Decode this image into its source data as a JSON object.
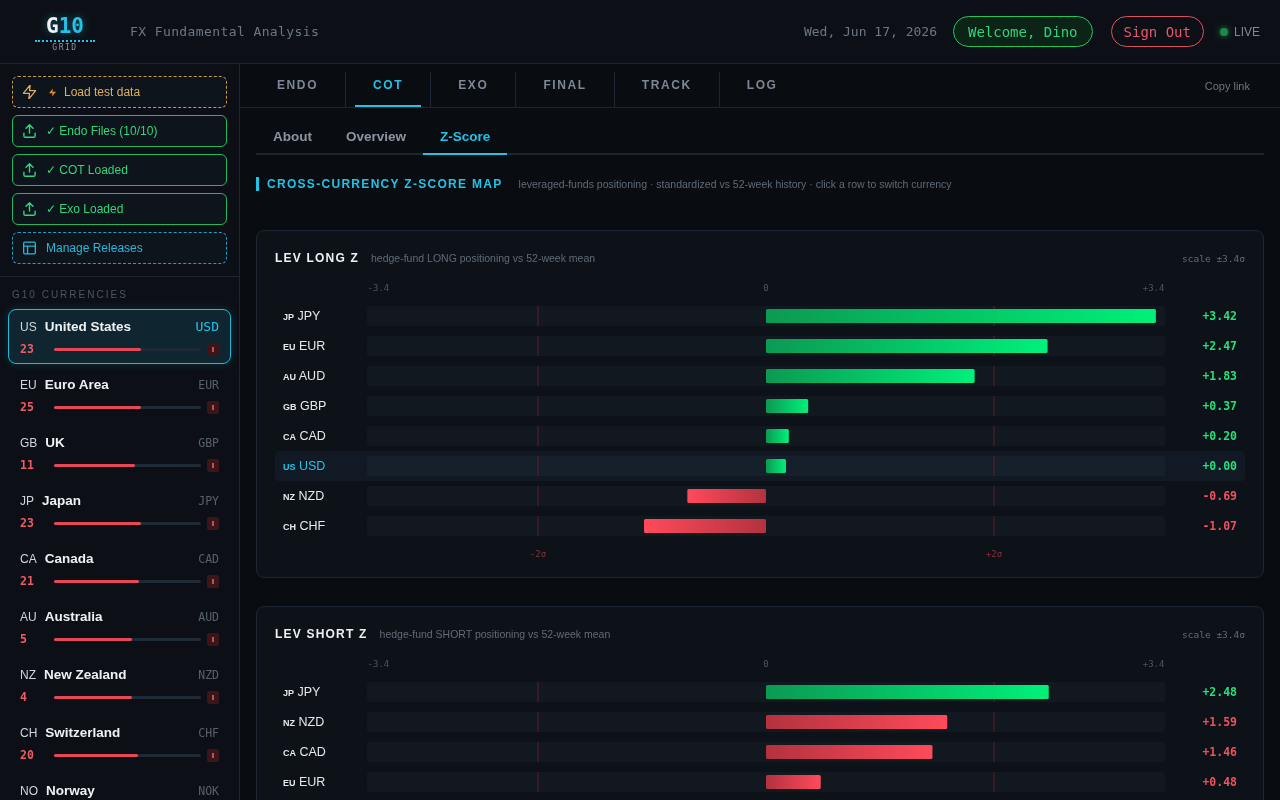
{
  "header": {
    "logo": {
      "mark": "G",
      "accent": "10",
      "caption": "GRID"
    },
    "subtitle": "FX Fundamental Analysis",
    "date": "Wed, Jun 17, 2026",
    "welcome": "Welcome, Dino",
    "sign_out": "Sign Out",
    "status": {
      "label": "LIVE",
      "on": true
    }
  },
  "sidebar": {
    "actions": [
      {
        "kind": "demo",
        "label": "Load test data"
      },
      {
        "kind": "upload",
        "label": "✓ Endo Files (10/10)"
      },
      {
        "kind": "upload",
        "label": "✓ COT Loaded"
      },
      {
        "kind": "upload",
        "label": "✓ Exo Loaded"
      },
      {
        "kind": "releases",
        "label": "Manage Releases"
      }
    ],
    "currencies_title": "G10 CURRENCIES",
    "currencies": [
      {
        "country": "US",
        "name": "United States",
        "code": "USD",
        "score": "23",
        "level": 0.59,
        "selected": true
      },
      {
        "country": "EU",
        "name": "Euro Area",
        "code": "EUR",
        "score": "25",
        "level": 0.59,
        "selected": false
      },
      {
        "country": "GB",
        "name": "UK",
        "code": "GBP",
        "score": "11",
        "level": 0.55,
        "selected": false
      },
      {
        "country": "JP",
        "name": "Japan",
        "code": "JPY",
        "score": "23",
        "level": 0.59,
        "selected": false
      },
      {
        "country": "CA",
        "name": "Canada",
        "code": "CAD",
        "score": "21",
        "level": 0.58,
        "selected": false
      },
      {
        "country": "AU",
        "name": "Australia",
        "code": "AUD",
        "score": "5",
        "level": 0.53,
        "selected": false
      },
      {
        "country": "NZ",
        "name": "New Zealand",
        "code": "NZD",
        "score": "4",
        "level": 0.53,
        "selected": false
      },
      {
        "country": "CH",
        "name": "Switzerland",
        "code": "CHF",
        "score": "20",
        "level": 0.57,
        "selected": false
      },
      {
        "country": "NO",
        "name": "Norway",
        "code": "NOK",
        "selected": false
      }
    ]
  },
  "tabs": [
    {
      "label": "ENDO",
      "selected": false
    },
    {
      "label": "COT",
      "selected": true
    },
    {
      "label": "EXO",
      "selected": false
    },
    {
      "label": "FINAL",
      "selected": false
    },
    {
      "label": "TRACK",
      "selected": false
    },
    {
      "label": "LOG",
      "selected": false
    }
  ],
  "copy_link": "Copy link",
  "subtabs": [
    {
      "label": "About",
      "selected": false
    },
    {
      "label": "Overview",
      "selected": false
    },
    {
      "label": "Z-Score",
      "selected": true
    }
  ],
  "section": {
    "title": "CROSS-CURRENCY Z-SCORE MAP",
    "subtitle": "leveraged-funds positioning · standardized vs 52-week history · click a row to switch currency"
  },
  "cards": [
    {
      "title": "LEV LONG Z",
      "subtitle": "hedge-fund LONG positioning vs 52-week mean",
      "scale": "scale ±3.4σ",
      "rows": [
        {
          "country": "JP",
          "kind": "bullish",
          "selected": false
        },
        {
          "country": "EU",
          "kind": "bullish",
          "selected": false
        },
        {
          "country": "AU",
          "kind": "bullish",
          "selected": false
        },
        {
          "country": "GB",
          "kind": "bullish",
          "selected": false
        },
        {
          "country": "CA",
          "kind": "bullish",
          "selected": false
        },
        {
          "country": "US",
          "kind": "bullish",
          "selected": true
        },
        {
          "country": "NZ",
          "kind": "bearish",
          "selected": false
        },
        {
          "country": "CH",
          "kind": "bearish",
          "selected": false
        }
      ],
      "chart_data": {
        "type": "bar",
        "orientation": "horizontal",
        "categories": [
          "JPY",
          "EUR",
          "AUD",
          "GBP",
          "CAD",
          "USD",
          "NZD",
          "CHF"
        ],
        "values": [
          3.42,
          2.47,
          1.83,
          0.37,
          0.2,
          0.0,
          -0.69,
          -1.07
        ],
        "value_labels": [
          "+3.42",
          "+2.47",
          "+1.83",
          "+0.37",
          "+0.20",
          "+0.00",
          "-0.69",
          "-1.07"
        ],
        "xlim": [
          -3.5,
          3.5
        ],
        "xticks": [
          {
            "value": -3.4,
            "label": "-3.4"
          },
          {
            "value": 0,
            "label": "0"
          },
          {
            "value": 3.4,
            "label": "+3.4"
          }
        ],
        "ref_lines": [
          {
            "axis": "x",
            "value": -2,
            "label": "-2σ"
          },
          {
            "axis": "x",
            "value": 2,
            "label": "+2σ"
          }
        ]
      }
    },
    {
      "title": "LEV SHORT Z",
      "subtitle": "hedge-fund SHORT positioning vs 52-week mean",
      "scale": "scale ±3.4σ",
      "rows": [
        {
          "country": "JP",
          "kind": "bullish",
          "selected": false
        },
        {
          "country": "NZ",
          "kind": "bearish",
          "selected": false
        },
        {
          "country": "CA",
          "kind": "bearish",
          "selected": false
        },
        {
          "country": "EU",
          "kind": "bearish",
          "selected": false
        }
      ],
      "chart_data": {
        "type": "bar",
        "orientation": "horizontal",
        "categories": [
          "JPY",
          "NZD",
          "CAD",
          "EUR"
        ],
        "values": [
          2.48,
          1.59,
          1.46,
          0.48
        ],
        "value_labels": [
          "+2.48",
          "+1.59",
          "+1.46",
          "+0.48"
        ],
        "xlim": [
          -3.5,
          3.5
        ],
        "xticks": [
          {
            "value": -3.4,
            "label": "-3.4"
          },
          {
            "value": 0,
            "label": "0"
          },
          {
            "value": 3.4,
            "label": "+3.4"
          }
        ],
        "ref_lines": [
          {
            "axis": "x",
            "value": -2
          },
          {
            "axis": "x",
            "value": 2
          }
        ]
      }
    }
  ]
}
